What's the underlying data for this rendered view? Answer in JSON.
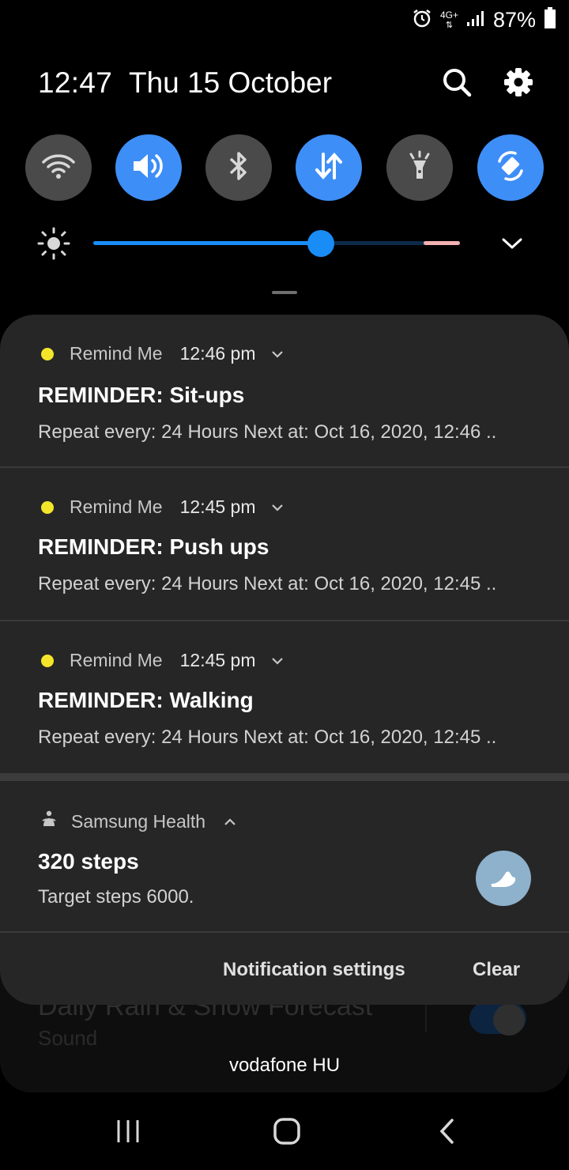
{
  "status_bar": {
    "battery_percent": "87%",
    "network": "4G+"
  },
  "header": {
    "time": "12:47",
    "date": "Thu 15 October"
  },
  "quick_settings": [
    {
      "name": "wifi",
      "state": "off"
    },
    {
      "name": "sound",
      "state": "on"
    },
    {
      "name": "bluetooth",
      "state": "off"
    },
    {
      "name": "mobile-data",
      "state": "on"
    },
    {
      "name": "flashlight",
      "state": "off"
    },
    {
      "name": "auto-rotate",
      "state": "on"
    }
  ],
  "brightness": {
    "level": 0.62
  },
  "notifications": [
    {
      "app": "Remind Me",
      "time": "12:46 pm",
      "title": "REMINDER: Sit-ups",
      "body": "Repeat every: 24 Hours  Next at: Oct 16, 2020, 12:46 .."
    },
    {
      "app": "Remind Me",
      "time": "12:45 pm",
      "title": "REMINDER: Push ups",
      "body": "Repeat every: 24 Hours  Next at: Oct 16, 2020, 12:45 .."
    },
    {
      "app": "Remind Me",
      "time": "12:45 pm",
      "title": "REMINDER: Walking",
      "body": "Repeat every: 24 Hours  Next at: Oct 16, 2020, 12:45 .."
    }
  ],
  "health": {
    "app": "Samsung Health",
    "title": "320 steps",
    "body": "Target steps 6000."
  },
  "footer": {
    "settings_label": "Notification settings",
    "clear_label": "Clear"
  },
  "background_notification": {
    "title": "Daily Rain & Snow Forecast",
    "subtitle": "Sound"
  },
  "carrier": "vodafone HU",
  "colors": {
    "accent": "#3e8ef7",
    "panel": "#262626",
    "reminder_dot": "#f5e52a"
  }
}
